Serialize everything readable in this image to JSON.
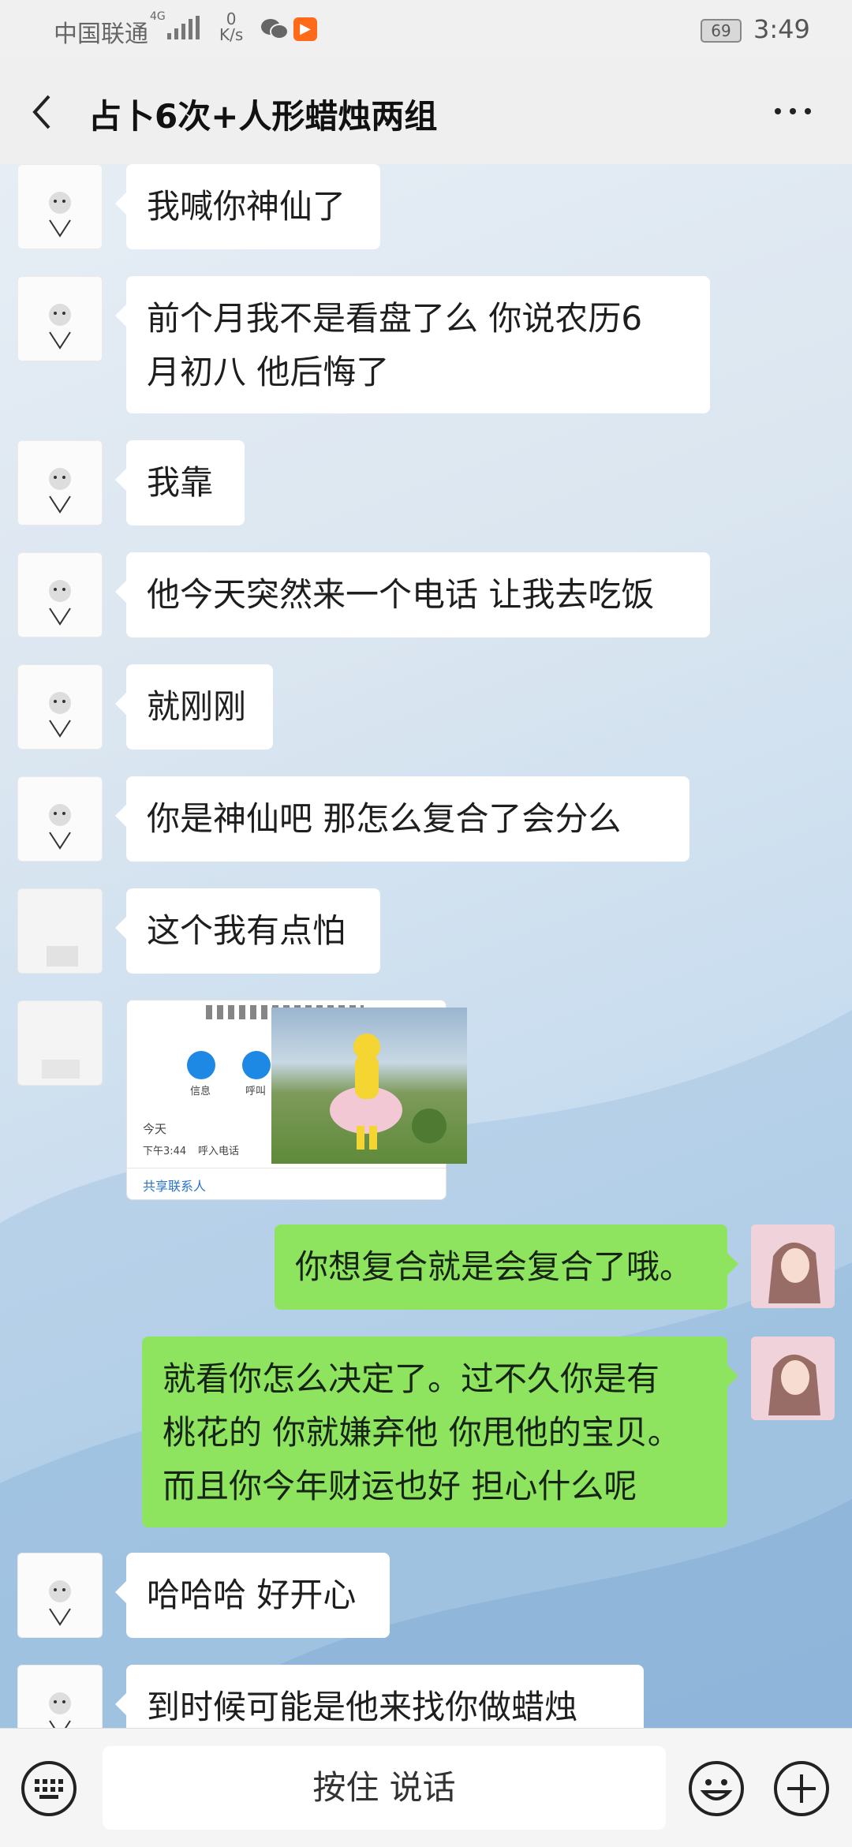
{
  "status_bar": {
    "carrier": "中国联通",
    "network": "4G",
    "speed_value": "0",
    "speed_unit": "K/s",
    "battery": "69",
    "time": "3:49"
  },
  "header": {
    "title": "占卜6次+人形蜡烛两组",
    "back_icon": "chevron-left-icon",
    "more_icon": "more-dots-icon"
  },
  "messages": [
    {
      "side": "left",
      "lines": [
        "我喊你神仙了"
      ]
    },
    {
      "side": "left",
      "lines": [
        "前个月我不是看盘了么 你说农历6",
        "月初八 他后悔了"
      ]
    },
    {
      "side": "left",
      "lines": [
        "我靠"
      ]
    },
    {
      "side": "left",
      "lines": [
        "他今天突然来一个电话 让我去吃饭"
      ]
    },
    {
      "side": "left",
      "lines": [
        "就刚刚"
      ]
    },
    {
      "side": "left",
      "lines": [
        "你是神仙吧 那怎么复合了会分么"
      ]
    },
    {
      "side": "left",
      "lines": [
        "这个我有点怕"
      ]
    },
    {
      "side": "right",
      "lines": [
        "你想复合就是会复合了哦。"
      ]
    },
    {
      "side": "right",
      "lines": [
        "就看你怎么决定了。过不久你是有",
        "桃花的 你就嫌弃他  你甩他的宝贝。",
        "而且你今年财运也好 担心什么呢"
      ]
    },
    {
      "side": "left",
      "lines": [
        "哈哈哈 好开心"
      ]
    },
    {
      "side": "left",
      "lines": [
        "到时候可能是他来找你做蜡烛"
      ]
    }
  ],
  "shared_image": {
    "icon1_label": "信息",
    "icon2_label": "呼叫",
    "today": "今天",
    "call_time": "下午3:44",
    "call_type": "呼入电话",
    "link": "共享联系人"
  },
  "input_bar": {
    "keyboard_icon": "keyboard-icon",
    "voice_label": "按住 说话",
    "emoji_icon": "emoji-icon",
    "plus_icon": "plus-icon"
  }
}
